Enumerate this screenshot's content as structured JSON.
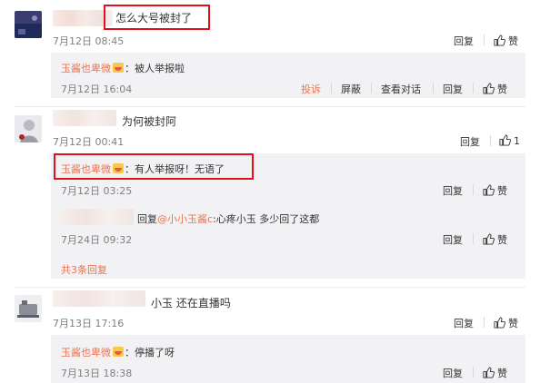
{
  "comments": [
    {
      "text": "怎么大号被封了",
      "time": "7月12日 08:45",
      "reply_label": "回复",
      "like_label": "赞",
      "sub_reply": {
        "author": "玉酱也卑微",
        "text": "：被人举报啦",
        "time": "7月12日 16:04",
        "report_label": "投诉",
        "block_label": "屏蔽",
        "view_convo_label": "查看对话",
        "reply_label": "回复",
        "like_label": "赞"
      }
    },
    {
      "text": "为何被封阿",
      "time": "7月12日 00:41",
      "reply_label": "回复",
      "like_count": "1",
      "sub_replies": [
        {
          "author": "玉酱也卑微",
          "text": "：有人举报呀！无语了",
          "time": "7月12日 03:25",
          "reply_label": "回复",
          "like_label": "赞"
        },
        {
          "prefix": "回复",
          "mention": "@小小玉酱c",
          "text": ":心疼小玉  多少回了这都",
          "time": "7月24日 09:32",
          "reply_label": "回复",
          "like_label": "赞"
        }
      ],
      "more_replies": "共3条回复"
    },
    {
      "text": "小玉  还在直播吗",
      "time": "7月13日 17:16",
      "reply_label": "回复",
      "like_label": "赞",
      "sub_reply": {
        "author": "玉酱也卑微",
        "text": "：停播了呀",
        "time": "7月13日 18:38",
        "reply_label": "回复",
        "like_label": "赞"
      }
    }
  ],
  "colors": {
    "accent": "#eb7350",
    "highlight_box": "#e0111d",
    "reply_bg": "#f2f2f5"
  }
}
